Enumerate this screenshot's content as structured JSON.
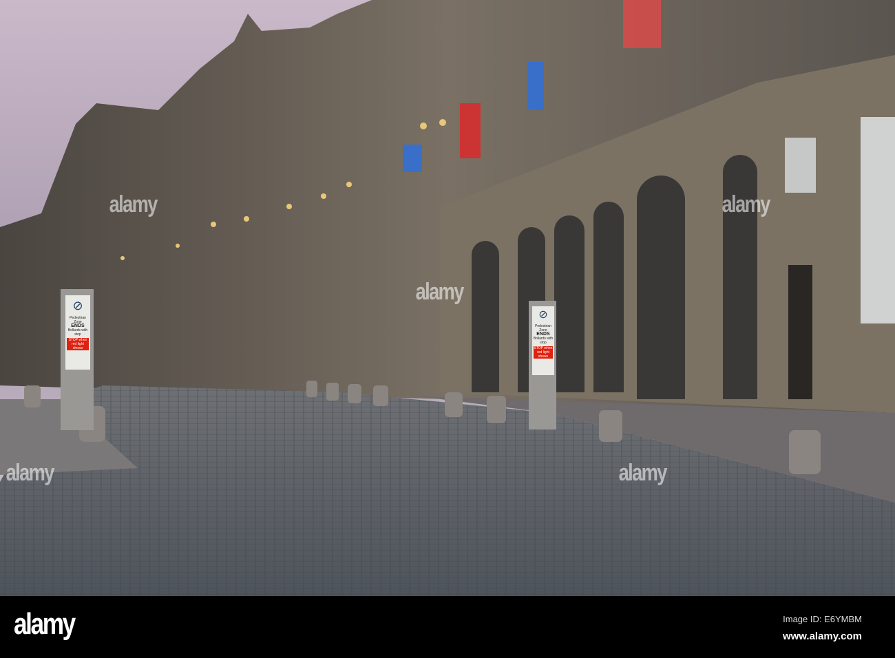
{
  "watermark": {
    "text": "alamy"
  },
  "footer": {
    "logo": "alamy",
    "image_id": "Image ID: E6YMBM",
    "website": "www.alamy.com"
  },
  "signs": {
    "line1": "Pedestrian Zone",
    "line2": "ENDS",
    "line3": "Bollards with stop",
    "line4": "STOP when red light shows"
  },
  "colors": {
    "sky": "#b9a7bd",
    "stone": "#6b6459",
    "cobbles": "#5e6369",
    "bar": "#000000"
  }
}
